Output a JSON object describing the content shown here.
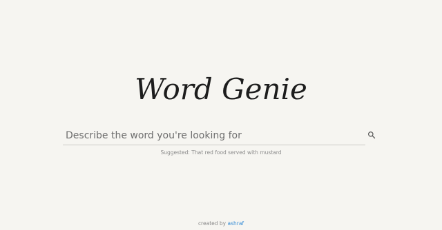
{
  "logo": {
    "text": "Word Genie"
  },
  "search": {
    "placeholder": "Describe the word you're looking for",
    "value": ""
  },
  "suggestion": {
    "text": "Suggested: That red food served with mustard"
  },
  "footer": {
    "prefix": "created by",
    "author": "ashraf"
  },
  "colors": {
    "background": "#f6f5f1",
    "text": "#1d1d1d",
    "muted": "#8a8a8a",
    "link": "#3b8fd6",
    "underline": "#c9c8c4"
  },
  "icons": {
    "search": "search-icon"
  }
}
